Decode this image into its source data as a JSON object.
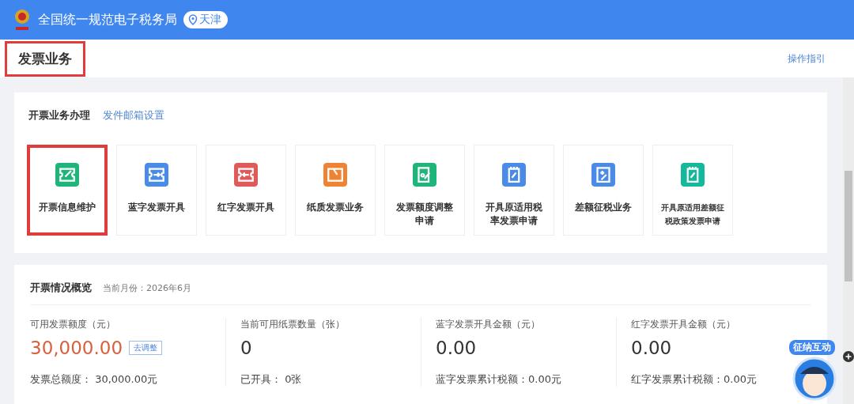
{
  "header": {
    "site_title": "全国统一规范电子税务局",
    "region": "天津"
  },
  "page": {
    "title": "发票业务",
    "highlighted": true,
    "guide_link": "操作指引"
  },
  "business": {
    "title": "开票业务办理",
    "link": "发件邮箱设置",
    "tiles": [
      {
        "label": "开票信息维护",
        "color": "#1fb57a",
        "highlighted": true,
        "small": false
      },
      {
        "label": "蓝字发票开具",
        "color": "#4a8be8",
        "highlighted": false,
        "small": false
      },
      {
        "label": "红字发票开具",
        "color": "#e05a5a",
        "highlighted": false,
        "small": false
      },
      {
        "label": "纸质发票业务",
        "color": "#ee8433",
        "highlighted": false,
        "small": false
      },
      {
        "label": "发票额度调整申请",
        "color": "#1fb57a",
        "highlighted": false,
        "small": false
      },
      {
        "label": "开具原适用税率发票申请",
        "color": "#4a8be8",
        "highlighted": false,
        "small": false
      },
      {
        "label": "差额征税业务",
        "color": "#4a8be8",
        "highlighted": false,
        "small": false
      },
      {
        "label": "开具原适用差额征税政策发票申请",
        "color": "#14b89a",
        "highlighted": false,
        "small": true
      }
    ]
  },
  "overview": {
    "title": "开票情况概览",
    "month": "当前月份：2026年6月",
    "stats": [
      {
        "label": "可用发票额度（元）",
        "value": "30,000.00",
        "emphasis": true,
        "action": "去调整",
        "detail": "发票总额度：  30,000.00元"
      },
      {
        "label": "当前可用纸票数量（张）",
        "value": "0",
        "emphasis": false,
        "detail": "已开具：  0张"
      },
      {
        "label": "蓝字发票开具金额（元）",
        "value": "0.00",
        "emphasis": false,
        "detail": "蓝字发票累计税额：0.00元"
      },
      {
        "label": "红字发票开具金额（元）",
        "value": "0.00",
        "emphasis": false,
        "detail": "红字发票累计税额：0.00元"
      }
    ]
  },
  "assistant": {
    "label": "征纳互动"
  }
}
